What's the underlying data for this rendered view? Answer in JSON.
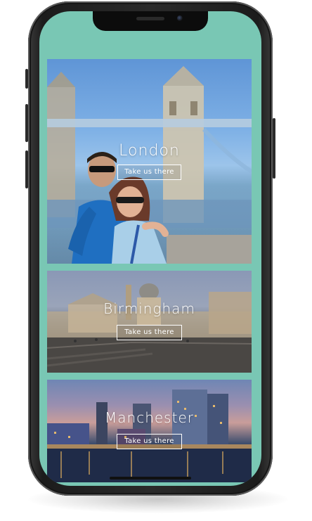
{
  "destinations": [
    {
      "city": "London",
      "cta_label": "Take us there"
    },
    {
      "city": "Birmingham",
      "cta_label": "Take us there"
    },
    {
      "city": "Manchester",
      "cta_label": "Take us there"
    }
  ],
  "theme": {
    "screen_background": "#79c7b4",
    "text_color": "#ffffff",
    "device_frame": "#1c1c1c"
  }
}
